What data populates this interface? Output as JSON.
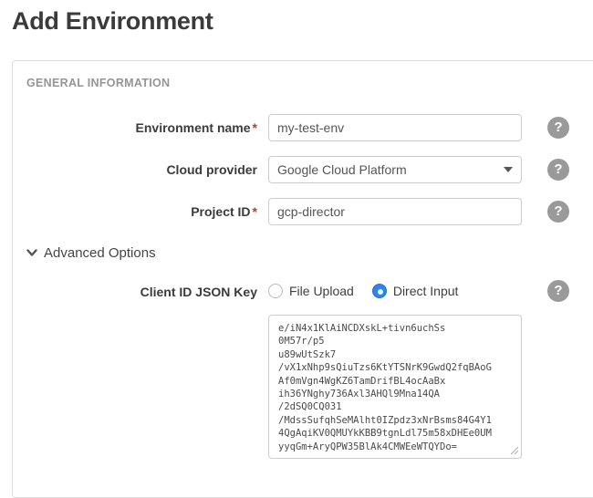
{
  "page": {
    "title": "Add Environment"
  },
  "panel": {
    "section_heading": "GENERAL INFORMATION"
  },
  "fields": {
    "environment_name": {
      "label": "Environment name",
      "required_mark": "*",
      "value": "my-test-env"
    },
    "cloud_provider": {
      "label": "Cloud provider",
      "value": "Google Cloud Platform"
    },
    "project_id": {
      "label": "Project ID",
      "required_mark": "*",
      "value": "gcp-director"
    },
    "client_id_json_key": {
      "label": "Client ID JSON Key",
      "options": [
        {
          "label": "File Upload",
          "selected": false
        },
        {
          "label": "Direct Input",
          "selected": true
        }
      ],
      "value": "e/iN4x1KlAiNCDXskL+tivn6uchSs\n0M57r/p5\nu89wUtSzk7\n/vX1xNhp9sQiuTzs6KtYTSNrK9GwdQ2fqBAoG\nAf0mVgn4WgKZ6TamDrifBL4ocAaBx\nih36YNghy736Axl3AHQl9Mna14QA\n/2dSQ0CQ031\n/MdssSufqhSeMAlht0IZpdz3xNrBsms84G4Y1\n4QgAqiKV0QMUYkKBB9tgnLdl75m58xDHEe0UM\nyyqGm+AryQPW35BlAk4CMWEeWTQYDo="
    }
  },
  "advanced_options": {
    "label": "Advanced Options",
    "expanded": true
  },
  "icons": {
    "help_glyph": "?"
  },
  "colors": {
    "accent_blue": "#2e86e9",
    "required_red": "#c0392b",
    "help_gray": "#9a9a9a",
    "border_gray": "#cccccc",
    "heading_gray": "#959595"
  }
}
